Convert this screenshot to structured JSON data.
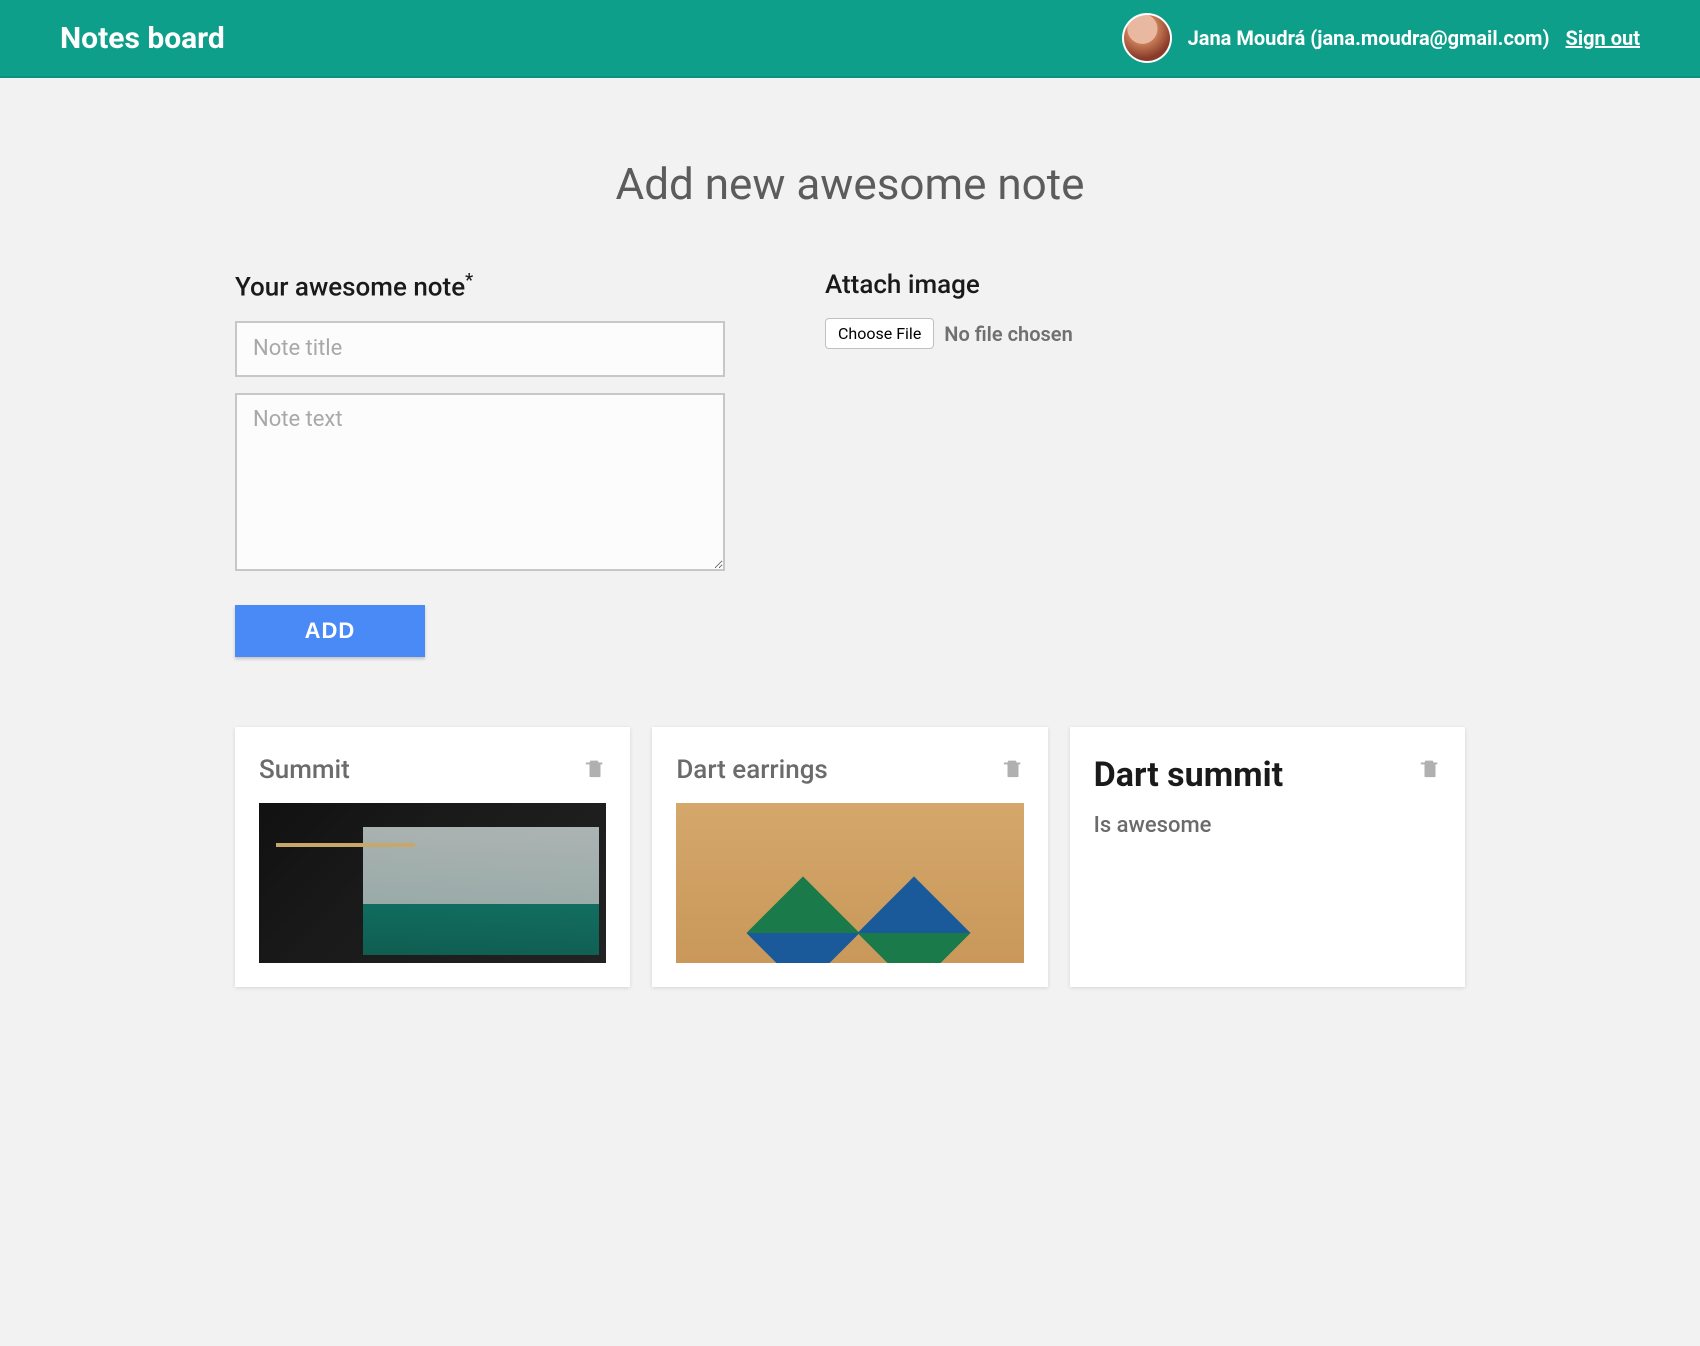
{
  "header": {
    "brand": "Notes board",
    "user_name": "Jana Moudrá",
    "user_email": "jana.moudra@gmail.com",
    "user_display": "Jana Moudrá (jana.moudra@gmail.com)",
    "signout": "Sign out"
  },
  "page": {
    "title": "Add new awesome note"
  },
  "form": {
    "note_label": "Your awesome note",
    "required_mark": "*",
    "title_placeholder": "Note title",
    "text_placeholder": "Note text",
    "attach_label": "Attach image",
    "choose_file": "Choose File",
    "file_status": "No file chosen",
    "add_button": "ADD"
  },
  "notes": [
    {
      "title": "Summit",
      "body": "",
      "emphasis": false,
      "has_image": true,
      "image_kind": "summit"
    },
    {
      "title": "Dart earrings",
      "body": "",
      "emphasis": false,
      "has_image": true,
      "image_kind": "earrings"
    },
    {
      "title": "Dart summit",
      "body": "Is awesome",
      "emphasis": true,
      "has_image": false,
      "image_kind": ""
    }
  ],
  "icons": {
    "trash": "trash-icon"
  },
  "colors": {
    "accent": "#0d9f89",
    "primary_button": "#4a8af7"
  }
}
